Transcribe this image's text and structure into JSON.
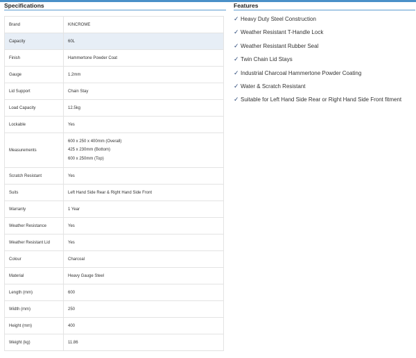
{
  "specifications": {
    "title": "Specifications",
    "rows": [
      {
        "label": "Brand",
        "value": "KINCROME"
      },
      {
        "label": "Capacity",
        "value": "60L"
      },
      {
        "label": "Finish",
        "value": "Hammertone Powder Coat"
      },
      {
        "label": "Gauge",
        "value": "1.2mm"
      },
      {
        "label": "Lid Support",
        "value": "Chain Stay"
      },
      {
        "label": "Load Capacity",
        "value": "12.5kg"
      },
      {
        "label": "Lockable",
        "value": "Yes"
      },
      {
        "label": "Measurements",
        "values": [
          "600 x 250 x 400mm (Overall)",
          "425 x 230mm (Bottom)",
          "600 x 250mm (Top)"
        ]
      },
      {
        "label": "Scratch Resistant",
        "value": "Yes"
      },
      {
        "label": "Suits",
        "value": "Left Hand Side Rear & Right Hand Side Front"
      },
      {
        "label": "Warranty",
        "value": "1 Year"
      },
      {
        "label": "Weather Resistance",
        "value": "Yes"
      },
      {
        "label": "Weather Resistant Lid",
        "value": "Yes"
      },
      {
        "label": "Colour",
        "value": "Charcoal"
      },
      {
        "label": "Material",
        "value": "Heavy Gauge Steel"
      },
      {
        "label": "Length (mm)",
        "value": "600"
      },
      {
        "label": "Width (mm)",
        "value": "250"
      },
      {
        "label": "Height (mm)",
        "value": "400"
      },
      {
        "label": "Weight (kg)",
        "value": "11.86"
      }
    ]
  },
  "features": {
    "title": "Features",
    "check_icon": "check-icon",
    "items": [
      "Heavy Duty Steel Construction",
      "Weather Resistant T-Handle Lock",
      "Weather Resistant Rubber Seal",
      "Twin Chain Lid Stays",
      "Industrial Charcoal Hammertone Powder Coating",
      "Water & Scratch Resistant",
      "Suitable for Left Hand Side Rear or Right Hand Side Front fitment"
    ]
  },
  "colors": {
    "accent": "#4a90c8",
    "highlight_row": "#e7eef6",
    "check": "#2c4a7a"
  }
}
